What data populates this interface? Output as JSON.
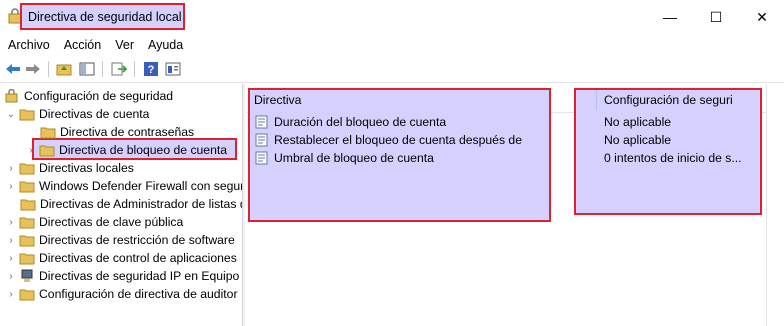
{
  "window": {
    "title": "Directiva de seguridad local",
    "controls": {
      "minimize": "—",
      "maximize": "☐",
      "close": "✕"
    }
  },
  "menu": [
    "Archivo",
    "Acción",
    "Ver",
    "Ayuda"
  ],
  "toolbar": {
    "icons": [
      "back-arrow-icon",
      "forward-arrow-icon",
      "up-folder-icon",
      "show-hide-tree-icon",
      "export-list-icon",
      "help-icon",
      "properties-icon"
    ]
  },
  "tree": {
    "root": "Configuración de seguridad",
    "items": [
      {
        "label": "Directivas de cuenta",
        "expanded": true
      },
      {
        "label": "Directiva de contraseñas"
      },
      {
        "label": "Directiva de bloqueo de cuenta",
        "selected": true
      },
      {
        "label": "Directivas locales"
      },
      {
        "label": "Windows Defender Firewall con segur"
      },
      {
        "label": "Directivas de Administrador de listas d"
      },
      {
        "label": "Directivas de clave pública"
      },
      {
        "label": "Directivas de restricción de software"
      },
      {
        "label": "Directivas de control de aplicaciones"
      },
      {
        "label": "Directivas de seguridad IP en Equipo l"
      },
      {
        "label": "Configuración de directiva de auditor"
      }
    ]
  },
  "list": {
    "columns": [
      "Directiva",
      "Configuración de seguri"
    ],
    "rows": [
      {
        "policy": "Duración del bloqueo de cuenta",
        "setting": "No aplicable"
      },
      {
        "policy": "Restablecer el bloqueo de cuenta después de",
        "setting": "No aplicable"
      },
      {
        "policy": "Umbral de bloqueo de cuenta",
        "setting": "0 intentos de inicio de s..."
      }
    ]
  },
  "colors": {
    "highlight_fill": "#d4d1ff",
    "highlight_border": "#e0202c",
    "folder": "#e8c15a"
  }
}
